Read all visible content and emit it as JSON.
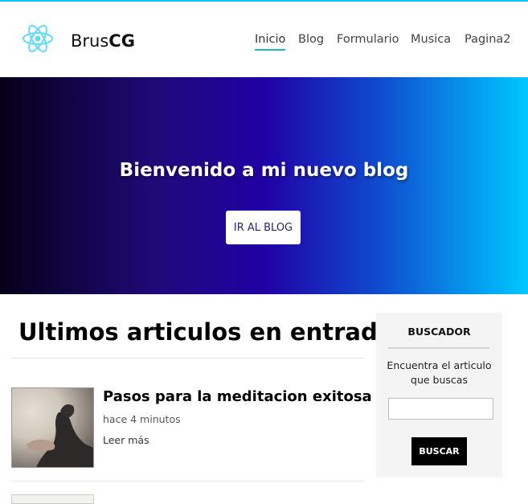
{
  "header": {
    "brand_prefix": "Brus",
    "brand_bold": "CG",
    "logo_icon": "react-atom-icon",
    "accent": "#1db7c7",
    "nav": [
      {
        "label": "Inicio",
        "active": true
      },
      {
        "label": "Blog",
        "active": false
      },
      {
        "label": "Formulario",
        "active": false
      },
      {
        "label": "Musica",
        "active": false
      },
      {
        "label": "Pagina2",
        "active": false
      }
    ]
  },
  "hero": {
    "title": "Bienvenido a mi nuevo blog",
    "button_label": "IR AL BLOG",
    "gradient": [
      "#05001a",
      "#2100a5",
      "#00c8ff"
    ]
  },
  "main": {
    "section_title": "Ultimos articulos en entrada",
    "posts": [
      {
        "title": "Pasos para la meditacion exitosa",
        "time": "hace 4 minutos",
        "more_label": "Leer más"
      }
    ]
  },
  "sidebar": {
    "title": "BUSCADOR",
    "text": "Encuentra el articulo que buscas",
    "input_value": "",
    "button_label": "BUSCAR"
  }
}
